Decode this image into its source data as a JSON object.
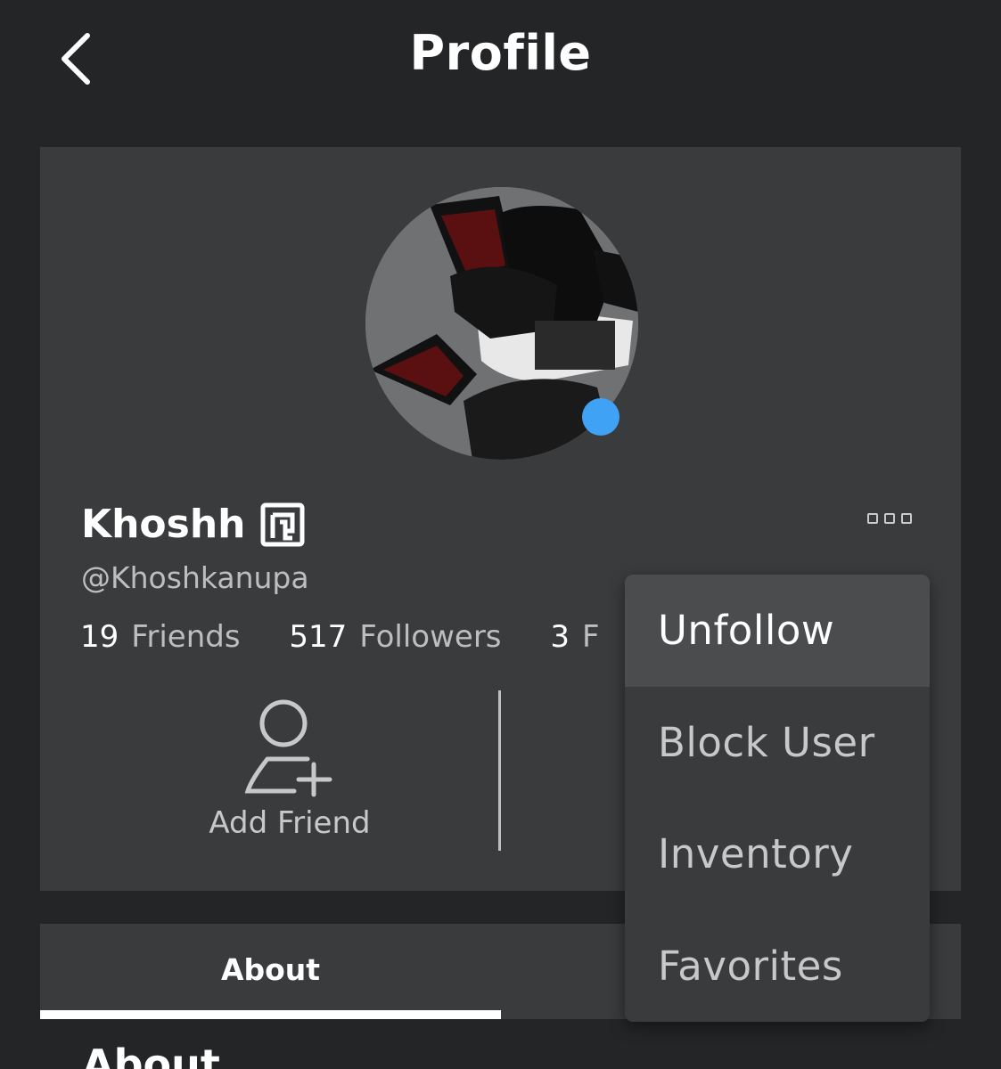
{
  "header": {
    "title": "Profile",
    "back_icon": "chevron-left-icon"
  },
  "profile": {
    "display_name": "Khoshh",
    "badge_icon": "premium-badge-icon",
    "username": "@Khoshkanupa",
    "presence_color": "#3fa2f5",
    "stats": [
      {
        "value": "19",
        "label": "Friends"
      },
      {
        "value": "517",
        "label": "Followers"
      },
      {
        "value": "3",
        "label": "F"
      }
    ],
    "more_icon": "more-options-icon",
    "actions": {
      "add_friend_label": "Add Friend",
      "add_friend_icon": "add-friend-icon"
    }
  },
  "tabs": {
    "about_label": "About"
  },
  "section": {
    "heading": "About"
  },
  "menu": {
    "items": [
      {
        "label": "Unfollow"
      },
      {
        "label": "Block User"
      },
      {
        "label": "Inventory"
      },
      {
        "label": "Favorites"
      }
    ]
  },
  "colors": {
    "background": "#232527",
    "card": "#393b3d",
    "accent": "#3fa2f5",
    "text_secondary": "#bdbebe"
  }
}
